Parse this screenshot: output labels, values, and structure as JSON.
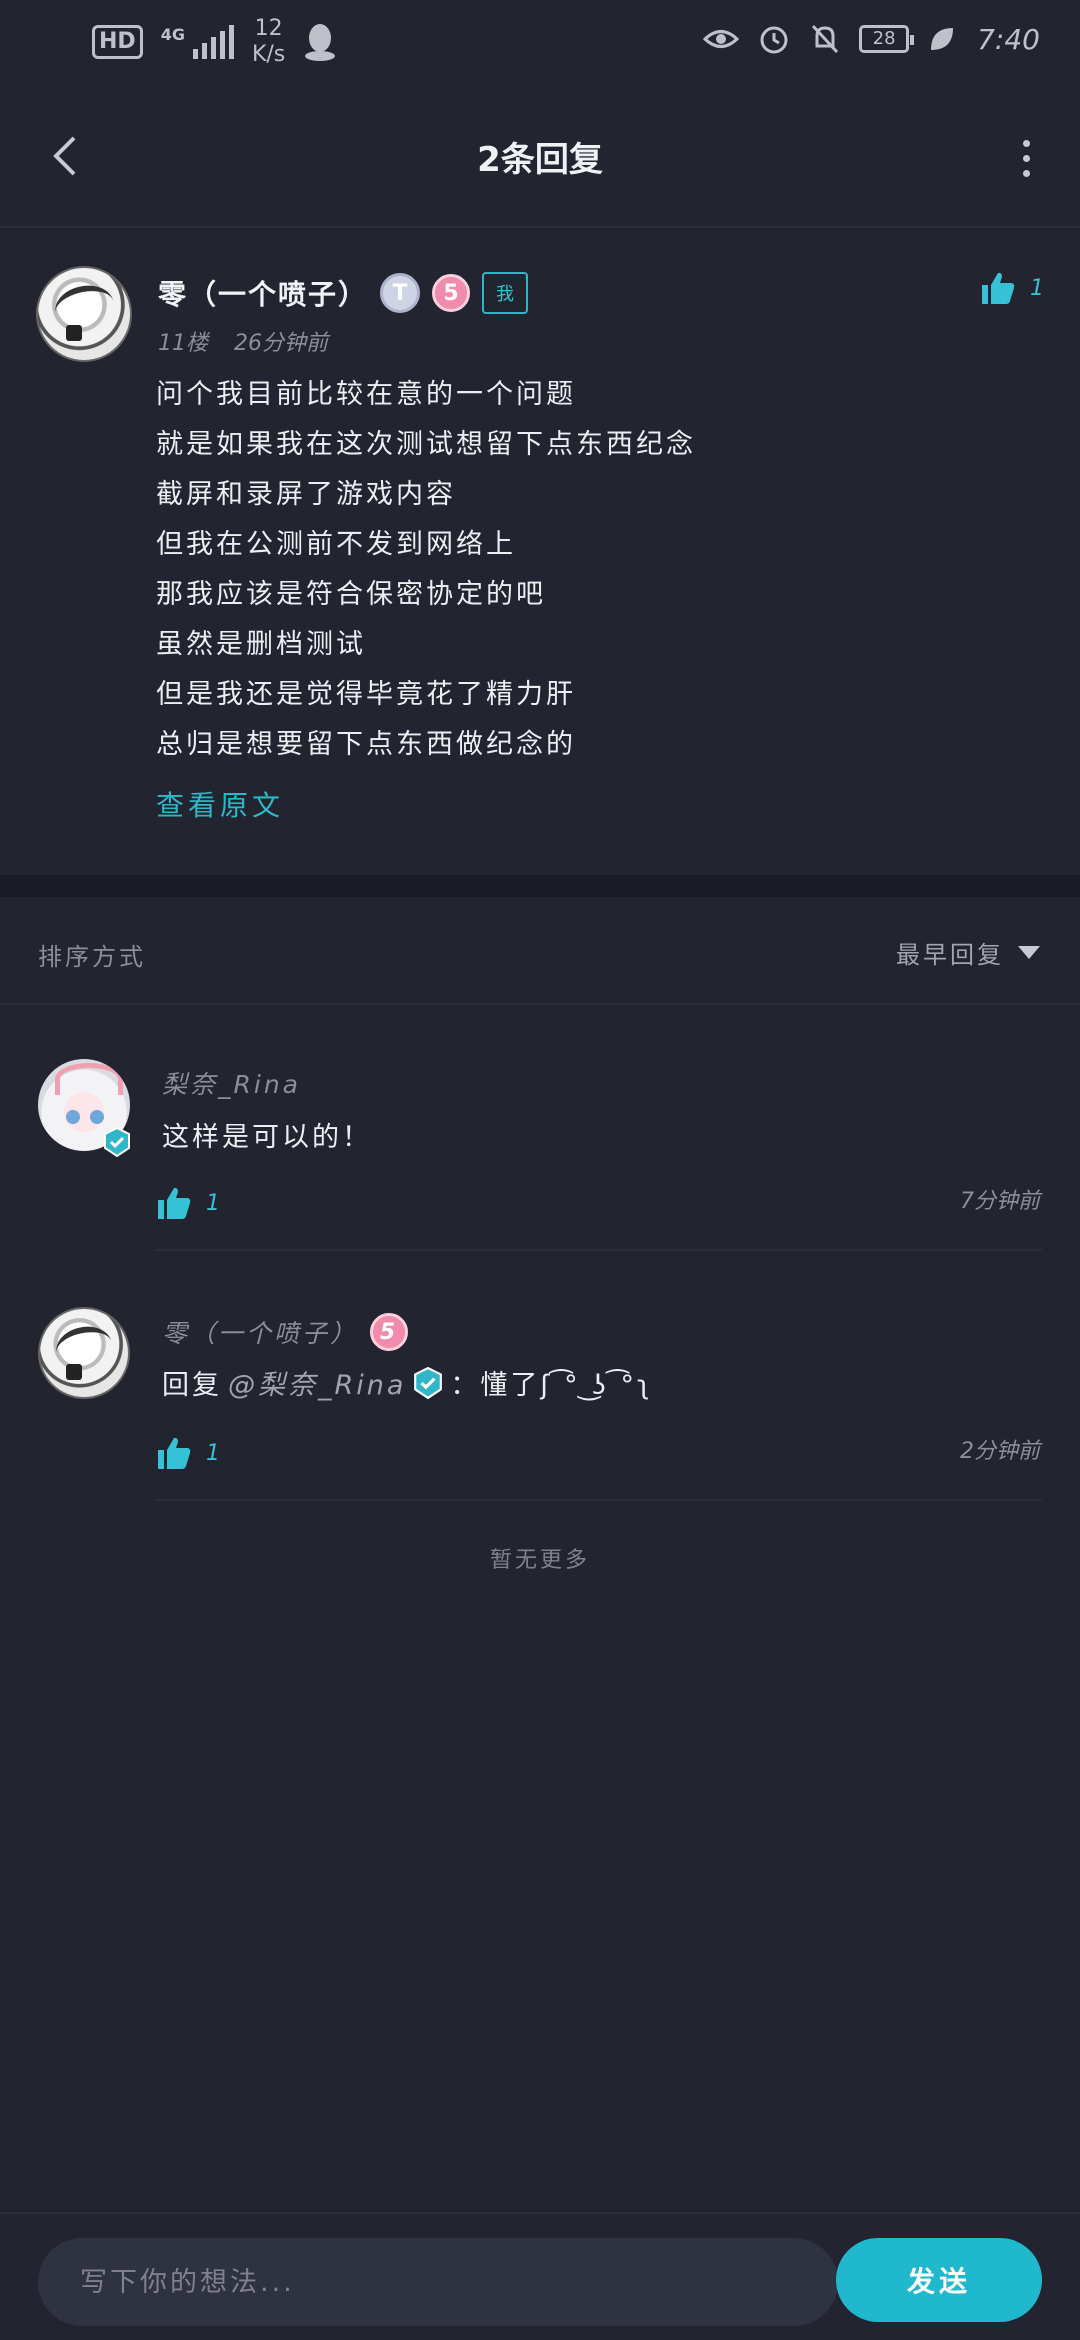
{
  "status_bar": {
    "hd": "HD",
    "network": "4G",
    "speed_value": "12",
    "speed_unit": "K/s",
    "battery": "28",
    "time": "7:40"
  },
  "header": {
    "title": "2条回复"
  },
  "post": {
    "username": "零（一个喷子）",
    "badge_t": "T",
    "badge_level": "5",
    "badge_me": "我",
    "likes": "1",
    "floor": "11楼",
    "time": "26分钟前",
    "lines": [
      "问个我目前比较在意的一个问题",
      "就是如果我在这次测试想留下点东西纪念",
      "截屏和录屏了游戏内容",
      "但我在公测前不发到网络上",
      "那我应该是符合保密协定的吧",
      "虽然是删档测试",
      "但是我还是觉得毕竟花了精力肝",
      "总归是想要留下点东西做纪念的"
    ],
    "view_original": "查看原文"
  },
  "sort": {
    "label": "排序方式",
    "selected": "最早回复"
  },
  "replies": [
    {
      "username": "梨奈_Rina",
      "text": "这样是可以的！",
      "likes": "1",
      "time": "7分钟前"
    },
    {
      "username": "零（一个喷子）",
      "badge_level": "5",
      "reply_prefix": "回复",
      "mention": "@梨奈_Rina",
      "text": "：懂了ʃ ͡° ͜ʖ ͡°ʅ",
      "likes": "1",
      "time": "2分钟前"
    }
  ],
  "no_more": "暂无更多",
  "composer": {
    "placeholder": "写下你的想法...",
    "send_label": "发送"
  },
  "colors": {
    "background": "#22242f",
    "accent": "#1fb8cc",
    "like": "#35c2d4"
  }
}
